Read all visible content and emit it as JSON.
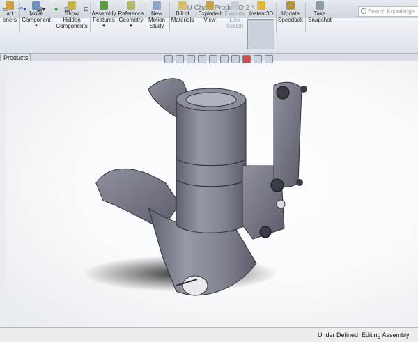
{
  "window": {
    "title": "BU Chain Produ 3D 2 *",
    "search_placeholder": "Search Knowledge"
  },
  "tabs": {
    "products": "Products"
  },
  "ribbon": [
    {
      "id": "smart-fasteners",
      "label": "art\neners",
      "disabled": false
    },
    {
      "id": "move-component",
      "label": "Move\nComponent",
      "disabled": false
    },
    {
      "id": "show-hidden",
      "label": "Show\nHidden\nComponents",
      "disabled": false
    },
    {
      "id": "assembly-features",
      "label": "Assembly\nFeatures",
      "disabled": false
    },
    {
      "id": "reference-geometry",
      "label": "Reference\nGeometry",
      "disabled": false
    },
    {
      "id": "new-motion-study",
      "label": "New\nMotion\nStudy",
      "disabled": false
    },
    {
      "id": "bill-of-materials",
      "label": "Bill of\nMaterials",
      "disabled": false
    },
    {
      "id": "exploded-view",
      "label": "Exploded\nView",
      "disabled": false
    },
    {
      "id": "explode-line-sketch",
      "label": "Explode\nLine\nSketch",
      "disabled": true
    },
    {
      "id": "instant3d",
      "label": "Instant3D",
      "disabled": false
    },
    {
      "id": "update-speedpak",
      "label": "Update\nSpeedpak",
      "disabled": false
    },
    {
      "id": "take-snapshot",
      "label": "Take\nSnapshot",
      "disabled": false
    }
  ],
  "status_bar": {
    "definition": "Under Defined",
    "mode": "Editing Assembly"
  },
  "colors": {
    "part": "#7e8190",
    "viewport_bg": "#f7f9fb",
    "ribbon_bg": "#e7ecf2"
  }
}
